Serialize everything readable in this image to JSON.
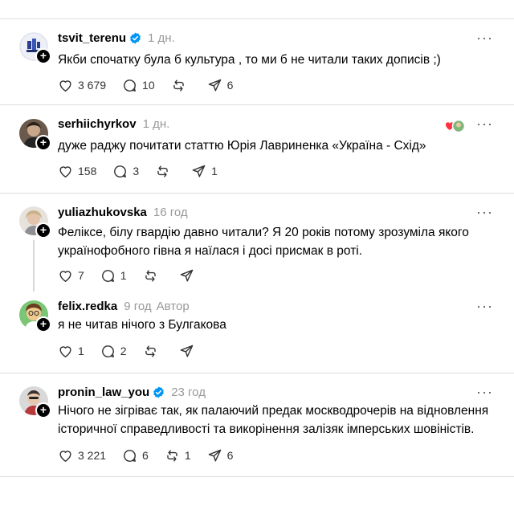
{
  "posts": [
    {
      "username": "tsvit_terenu",
      "verified": true,
      "time": "1 дн.",
      "text": "Якби спочатку була б культура , то ми б не читали таких дописів ;)",
      "likes": "3 679",
      "replies": "10",
      "reposts": "",
      "shares": "6"
    },
    {
      "username": "serhiichyrkov",
      "verified": false,
      "time": "1 дн.",
      "text": "дуже раджу почитати статтю Юрія Лавриненка «Україна - Схід»",
      "likes": "158",
      "replies": "3",
      "reposts": "",
      "shares": "1"
    },
    {
      "username": "yuliazhukovska",
      "verified": false,
      "time": "16 год",
      "text": "Феліксе, білу гвардію давно читали? Я 20 років потому зрозуміла якого українофобного гівна я наїлася і досі присмак в роті.",
      "likes": "7",
      "replies": "1",
      "reposts": "",
      "shares": ""
    },
    {
      "username": "felix.redka",
      "verified": false,
      "time": "9 год",
      "author_badge": "Автор",
      "text": "я не читав нічого з Булгакова",
      "likes": "1",
      "replies": "2",
      "reposts": "",
      "shares": ""
    },
    {
      "username": "pronin_law_you",
      "verified": true,
      "time": "23 год",
      "text": "Нічого не зігріває так, як палаючий предак москводрочерів на відновлення історичної справедливості та викорінення залізяк імперських шовіністів.",
      "likes": "3 221",
      "replies": "6",
      "reposts": "1",
      "shares": "6"
    }
  ],
  "icons": {
    "more": "more-icon",
    "like": "heart-icon",
    "reply": "comment-icon",
    "repost": "repost-icon",
    "share": "send-icon",
    "verified": "verified-badge-icon",
    "follow": "plus-icon"
  },
  "colors": {
    "verified": "#0095f6",
    "muted": "#999999",
    "divider": "#dbdbdb"
  }
}
